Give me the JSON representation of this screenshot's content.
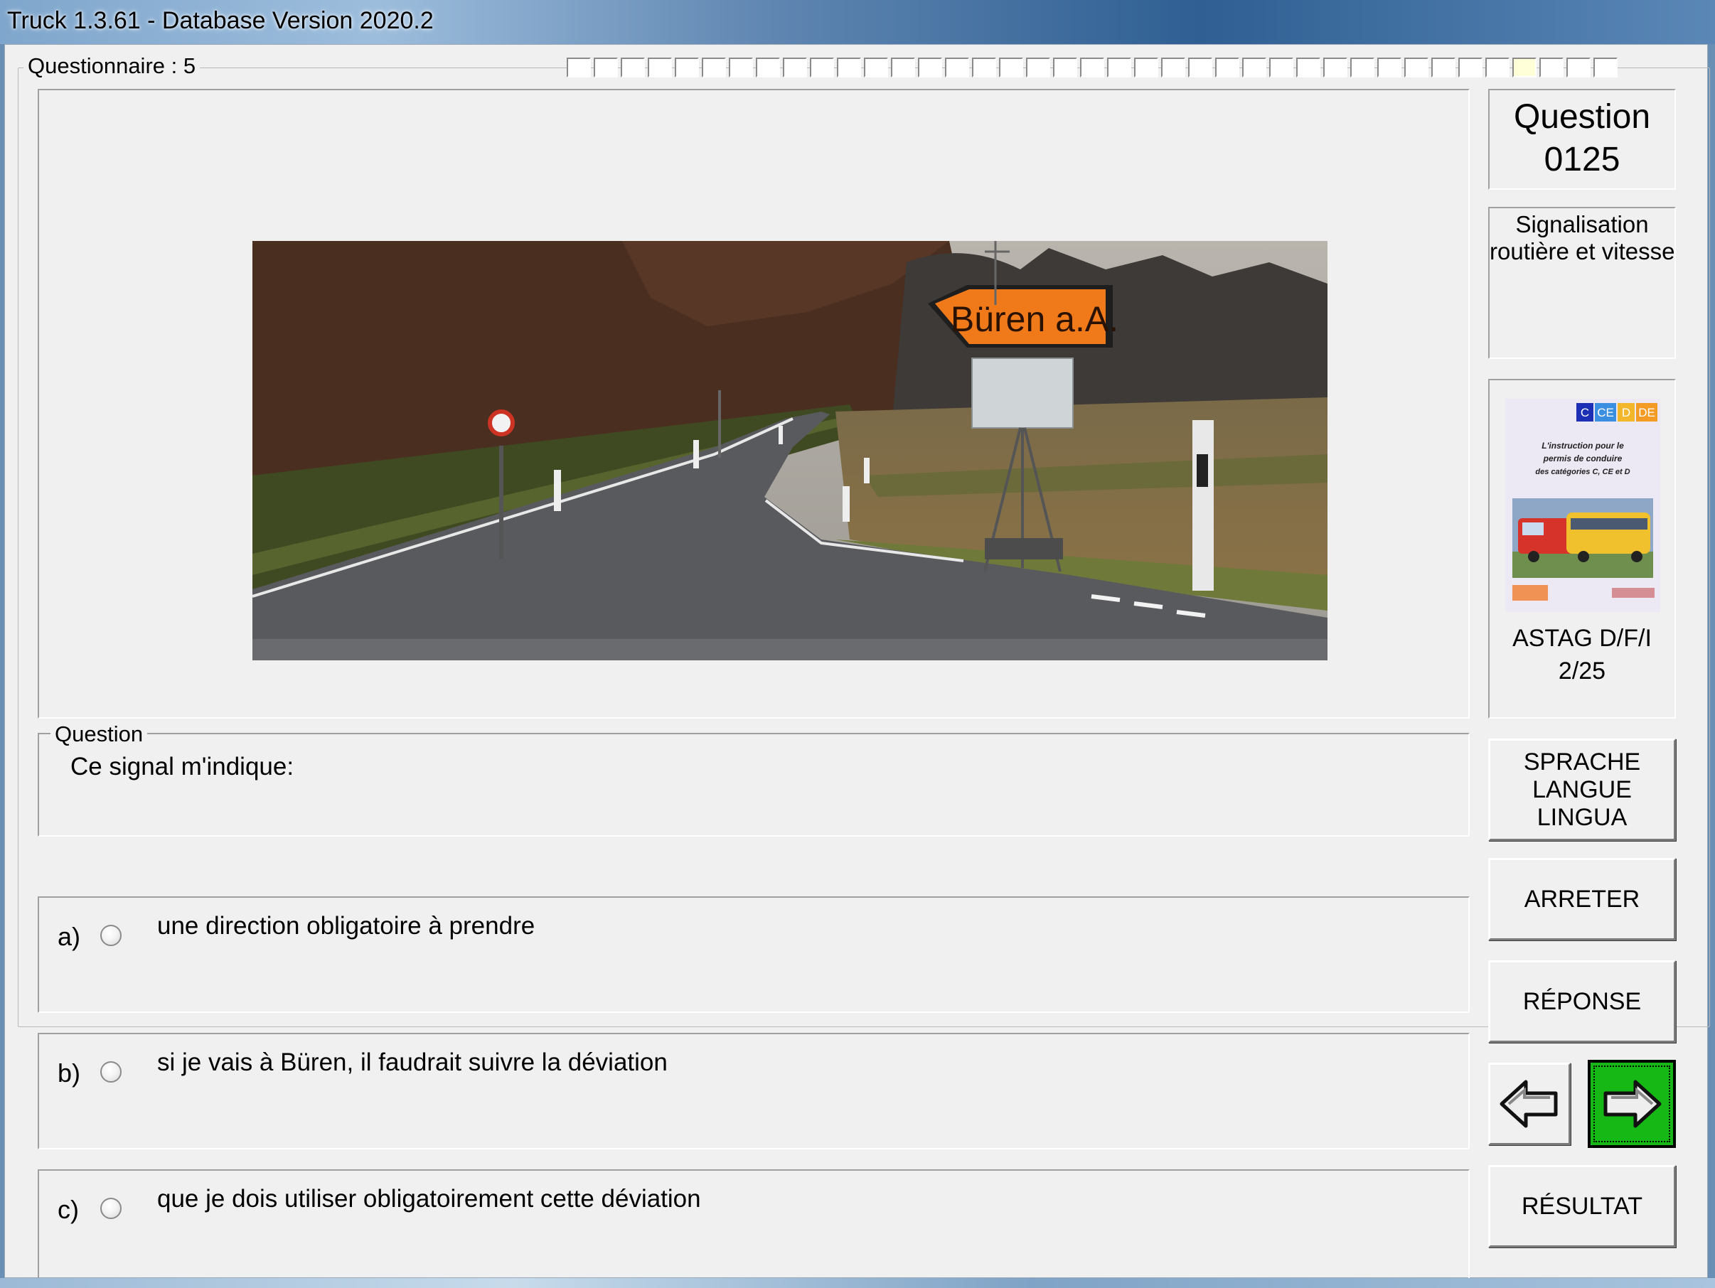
{
  "window": {
    "title": "Truck 1.3.61 - Database Version 2020.2"
  },
  "questionnaire": {
    "label": "Questionnaire : 5",
    "progress_total": 39,
    "progress_current": 36
  },
  "photo": {
    "sign_text": "Büren a.A."
  },
  "question_number": {
    "line1": "Question",
    "line2": "0125"
  },
  "category": {
    "line1": "Signalisation",
    "line2": "routière et vitesse"
  },
  "book": {
    "badges": [
      "C",
      "CE",
      "D",
      "DE"
    ],
    "cover_text": [
      "L'instruction pour le",
      "permis de conduire",
      "des catégories C, CE et D"
    ],
    "label_line1": "ASTAG D/F/I",
    "label_line2": "2/25"
  },
  "buttons": {
    "language": [
      "SPRACHE",
      "LANGUE",
      "LINGUA"
    ],
    "stop": "ARRETER",
    "response": "RÉPONSE",
    "result": "RÉSULTAT"
  },
  "question": {
    "legend": "Question",
    "text": "Ce signal m'indique:"
  },
  "answers": [
    {
      "letter": "a)",
      "text": "une direction obligatoire à prendre",
      "selected": false
    },
    {
      "letter": "b)",
      "text": "si je vais à Büren, il faudrait suivre la déviation",
      "selected": false
    },
    {
      "letter": "c)",
      "text": "que je dois utiliser obligatoirement cette déviation",
      "selected": false
    }
  ],
  "colors": {
    "next_button": "#16b816",
    "sign": "#f07a1a",
    "current_progress": "#ffffd8"
  }
}
